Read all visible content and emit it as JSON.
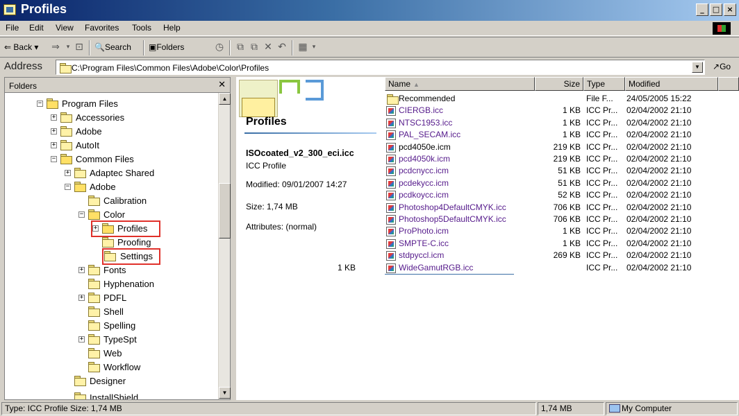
{
  "window": {
    "title": "Profiles"
  },
  "menu": [
    "File",
    "Edit",
    "View",
    "Favorites",
    "Tools",
    "Help"
  ],
  "toolbar": {
    "back": "Back",
    "search": "Search",
    "folders": "Folders"
  },
  "address": {
    "label": "Address",
    "path": "C:\\Program Files\\Common Files\\Adobe\\Color\\Profiles",
    "go": "Go"
  },
  "folders_pane": {
    "title": "Folders",
    "tree": [
      {
        "label": "Program Files",
        "exp": "−"
      },
      {
        "label": "Accessories",
        "exp": "+"
      },
      {
        "label": "Adobe",
        "exp": "+"
      },
      {
        "label": "AutoIt",
        "exp": "+"
      },
      {
        "label": "Common Files",
        "exp": "−"
      },
      {
        "label": "Adaptec Shared",
        "exp": "+"
      },
      {
        "label": "Adobe",
        "exp": "−"
      },
      {
        "label": "Calibration",
        "exp": ""
      },
      {
        "label": "Color",
        "exp": "−"
      },
      {
        "label": "Profiles",
        "exp": "+"
      },
      {
        "label": "Proofing",
        "exp": ""
      },
      {
        "label": "Settings",
        "exp": ""
      },
      {
        "label": "Fonts",
        "exp": "+"
      },
      {
        "label": "Hyphenation",
        "exp": ""
      },
      {
        "label": "PDFL",
        "exp": "+"
      },
      {
        "label": "Shell",
        "exp": ""
      },
      {
        "label": "Spelling",
        "exp": ""
      },
      {
        "label": "TypeSpt",
        "exp": "+"
      },
      {
        "label": "Web",
        "exp": ""
      },
      {
        "label": "Workflow",
        "exp": ""
      },
      {
        "label": "Designer",
        "exp": ""
      },
      {
        "label": "InstallShield",
        "exp": ""
      }
    ]
  },
  "details": {
    "folder_title": "Profiles",
    "file_name": "ISOcoated_v2_300_eci.icc",
    "file_type": "ICC Profile",
    "modified": "Modified: 09/01/2007 14:27",
    "size": "Size: 1,74 MB",
    "attributes": "Attributes: (normal)"
  },
  "list": {
    "columns": {
      "name": "Name",
      "size": "Size",
      "type": "Type",
      "modified": "Modified"
    },
    "rows": [
      {
        "name": "Recommended",
        "size": "",
        "type": "File F...",
        "modified": "24/05/2005 15:22",
        "kind": "folder"
      },
      {
        "name": "CIERGB.icc",
        "size": "1 KB",
        "type": "ICC Pr...",
        "modified": "02/04/2002 21:10",
        "kind": "icc-purple"
      },
      {
        "name": "NTSC1953.icc",
        "size": "1 KB",
        "type": "ICC Pr...",
        "modified": "02/04/2002 21:10",
        "kind": "icc-purple"
      },
      {
        "name": "PAL_SECAM.icc",
        "size": "1 KB",
        "type": "ICC Pr...",
        "modified": "02/04/2002 21:10",
        "kind": "icc-purple"
      },
      {
        "name": "pcd4050e.icm",
        "size": "219 KB",
        "type": "ICC Pr...",
        "modified": "02/04/2002 21:10",
        "kind": "icc"
      },
      {
        "name": "pcd4050k.icm",
        "size": "219 KB",
        "type": "ICC Pr...",
        "modified": "02/04/2002 21:10",
        "kind": "icc-purple"
      },
      {
        "name": "pcdcnycc.icm",
        "size": "51 KB",
        "type": "ICC Pr...",
        "modified": "02/04/2002 21:10",
        "kind": "icc-purple"
      },
      {
        "name": "pcdekycc.icm",
        "size": "51 KB",
        "type": "ICC Pr...",
        "modified": "02/04/2002 21:10",
        "kind": "icc-purple"
      },
      {
        "name": "pcdkoycc.icm",
        "size": "52 KB",
        "type": "ICC Pr...",
        "modified": "02/04/2002 21:10",
        "kind": "icc-purple"
      },
      {
        "name": "Photoshop4DefaultCMYK.icc",
        "size": "706 KB",
        "type": "ICC Pr...",
        "modified": "02/04/2002 21:10",
        "kind": "icc-purple"
      },
      {
        "name": "Photoshop5DefaultCMYK.icc",
        "size": "706 KB",
        "type": "ICC Pr...",
        "modified": "02/04/2002 21:10",
        "kind": "icc-purple"
      },
      {
        "name": "ProPhoto.icm",
        "size": "1 KB",
        "type": "ICC Pr...",
        "modified": "02/04/2002 21:10",
        "kind": "icc-purple"
      },
      {
        "name": "SMPTE-C.icc",
        "size": "1 KB",
        "type": "ICC Pr...",
        "modified": "02/04/2002 21:10",
        "kind": "icc-purple"
      },
      {
        "name": "stdpyccl.icm",
        "size": "269 KB",
        "type": "ICC Pr...",
        "modified": "02/04/2002 21:10",
        "kind": "icc-purple"
      },
      {
        "name": "WideGamutRGB.icc",
        "size": "1 KB",
        "type": "ICC Pr...",
        "modified": "02/04/2002 21:10",
        "kind": "icc-purple"
      }
    ]
  },
  "status": {
    "left": "Type: ICC Profile Size: 1,74 MB",
    "size": "1,74 MB",
    "zone": "My Computer"
  }
}
